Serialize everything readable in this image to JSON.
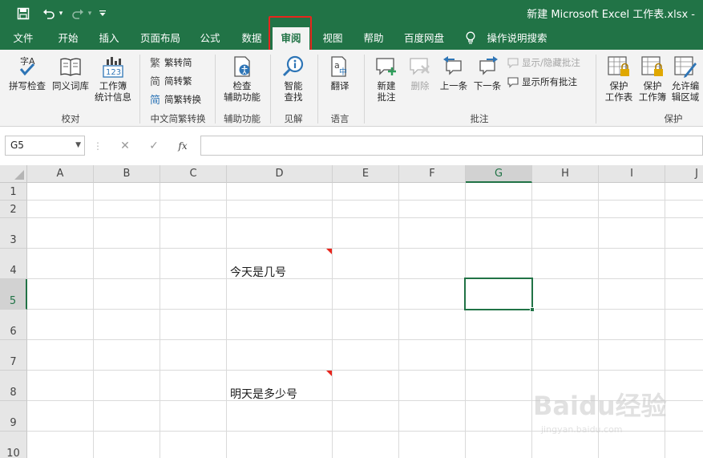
{
  "titlebar": {
    "filename": "新建 Microsoft Excel 工作表.xlsx  -"
  },
  "tabs": [
    {
      "label": "文件"
    },
    {
      "label": "开始"
    },
    {
      "label": "插入"
    },
    {
      "label": "页面布局"
    },
    {
      "label": "公式"
    },
    {
      "label": "数据"
    },
    {
      "label": "审阅",
      "active": true
    },
    {
      "label": "视图"
    },
    {
      "label": "帮助"
    },
    {
      "label": "百度网盘"
    },
    {
      "label": "操作说明搜索"
    }
  ],
  "ribbon": {
    "groups": {
      "proofing": "校对",
      "chinese": "中文简繁转换",
      "accessibility": "辅助功能",
      "insights": "见解",
      "language": "语言",
      "comments": "批注",
      "protect": "保护"
    },
    "buttons": {
      "spelling": "拼写检查",
      "thesaurus": "同义词库",
      "workbook_stats": "工作簿\n统计信息",
      "to_simplified": "繁转简",
      "to_traditional": "简转繁",
      "convert": "简繁转换",
      "check_access": "检查\n辅助功能",
      "smart_lookup": "智能\n查找",
      "translate": "翻译",
      "new_comment": "新建\n批注",
      "delete": "删除",
      "previous": "上一条",
      "next": "下一条",
      "show_hide_comment": "显示/隐藏批注",
      "show_all_comments": "显示所有批注",
      "protect_sheet": "保护\n工作表",
      "protect_workbook": "保护\n工作簿",
      "allow_edit_ranges": "允许编\n辑区域"
    }
  },
  "formula_bar": {
    "name_box": "G5",
    "fx": "fx",
    "value": ""
  },
  "sheet": {
    "columns": [
      "A",
      "B",
      "C",
      "D",
      "E",
      "F",
      "G",
      "H",
      "I",
      "J"
    ],
    "rows": [
      "1",
      "2",
      "3",
      "4",
      "5",
      "6",
      "7",
      "8",
      "9",
      "10"
    ],
    "selected_cell": "G5",
    "cells": {
      "D4": "今天是几号",
      "D8": "明天是多少号"
    }
  },
  "watermark": {
    "brand": "Baidu经验",
    "url": "jingyan.baidu.com"
  },
  "colors": {
    "excel_green": "#217346",
    "comment_red": "#e8251c"
  }
}
